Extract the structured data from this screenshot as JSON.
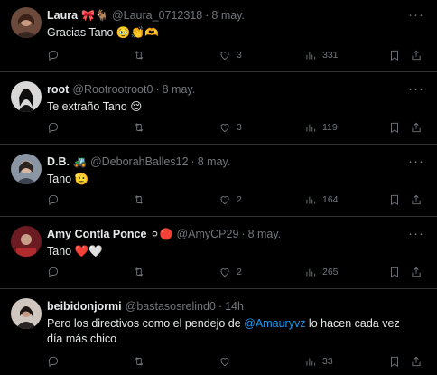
{
  "tweets": [
    {
      "name": "Laura",
      "name_emoji": "🎀🐐",
      "handle": "@Laura_0712318",
      "date": "8 may.",
      "text": "Gracias Tano 🥹👏🫶",
      "replies": "",
      "retweets": "",
      "likes": "3",
      "views": "331",
      "avatar_color": "#7a4a3a"
    },
    {
      "name": "root",
      "name_emoji": "",
      "handle": "@Rootrootroot0",
      "date": "8 may.",
      "text": "Te extraño Tano 😌",
      "replies": "",
      "retweets": "",
      "likes": "3",
      "views": "119",
      "avatar_color": "#2a2a2a"
    },
    {
      "name": "D.B.",
      "name_emoji": "🚜",
      "handle": "@DeborahBalles12",
      "date": "8 may.",
      "text": "Tano 🫡",
      "replies": "",
      "retweets": "",
      "likes": "2",
      "views": "164",
      "avatar_color": "#5a6470"
    },
    {
      "name": "Amy Contla Ponce",
      "name_emoji": "⚪🔴",
      "handle": "@AmyCP29",
      "date": "8 may.",
      "text": "Tano ❤️🤍",
      "replies": "",
      "retweets": "",
      "likes": "2",
      "views": "265",
      "avatar_color": "#8a2a30"
    },
    {
      "name": "beibidonjormi",
      "name_emoji": "",
      "handle": "@bastasosrelind0",
      "date": "14h",
      "text_before": "Pero los directivos como el pendejo de ",
      "mention": "@Amauryvz",
      "text_after": " lo hacen cada vez día más chico",
      "replies": "",
      "retweets": "",
      "likes": "",
      "views": "33",
      "avatar_color": "#4a3a36"
    }
  ],
  "icons": {
    "more": "more-horizontal-icon",
    "reply": "reply-icon",
    "retweet": "retweet-icon",
    "like": "heart-icon",
    "views": "views-chart-icon",
    "bookmark": "bookmark-icon",
    "share": "share-icon"
  },
  "colors": {
    "background": "#000000",
    "text": "#e7e9ea",
    "muted": "#71767b",
    "border": "#2f3336",
    "link": "#1d9bf0"
  }
}
